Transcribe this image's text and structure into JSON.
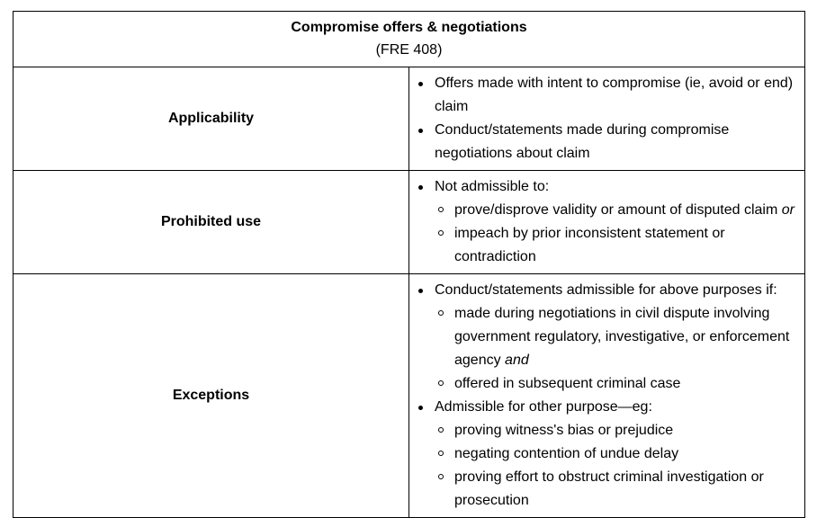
{
  "header": {
    "title": "Compromise offers & negotiations",
    "subtitle": "(FRE 408)"
  },
  "rows": [
    {
      "label": "Applicability",
      "items": [
        {
          "text": "Offers made with intent to compromise (ie, avoid or end) claim"
        },
        {
          "text": "Conduct/statements made during compromise negotiations about claim"
        }
      ]
    },
    {
      "label": "Prohibited use",
      "items": [
        {
          "text": "Not admissible to:",
          "sub": [
            {
              "text": "prove/disprove validity or amount of disputed claim ",
              "em": "or"
            },
            {
              "text": "impeach by prior inconsistent statement or contradiction"
            }
          ]
        }
      ]
    },
    {
      "label": "Exceptions",
      "items": [
        {
          "text": "Conduct/statements admissible for above purposes if:",
          "sub": [
            {
              "text": "made during negotiations in civil dispute involving government regulatory, investigative, or enforcement agency ",
              "em": "and"
            },
            {
              "text": "offered in subsequent criminal case"
            }
          ]
        },
        {
          "text": "Admissible for other purpose—eg:",
          "sub": [
            {
              "text": "proving witness's bias or prejudice"
            },
            {
              "text": "negating contention of undue delay"
            },
            {
              "text": "proving effort to obstruct criminal investigation or prosecution"
            }
          ]
        }
      ]
    }
  ]
}
